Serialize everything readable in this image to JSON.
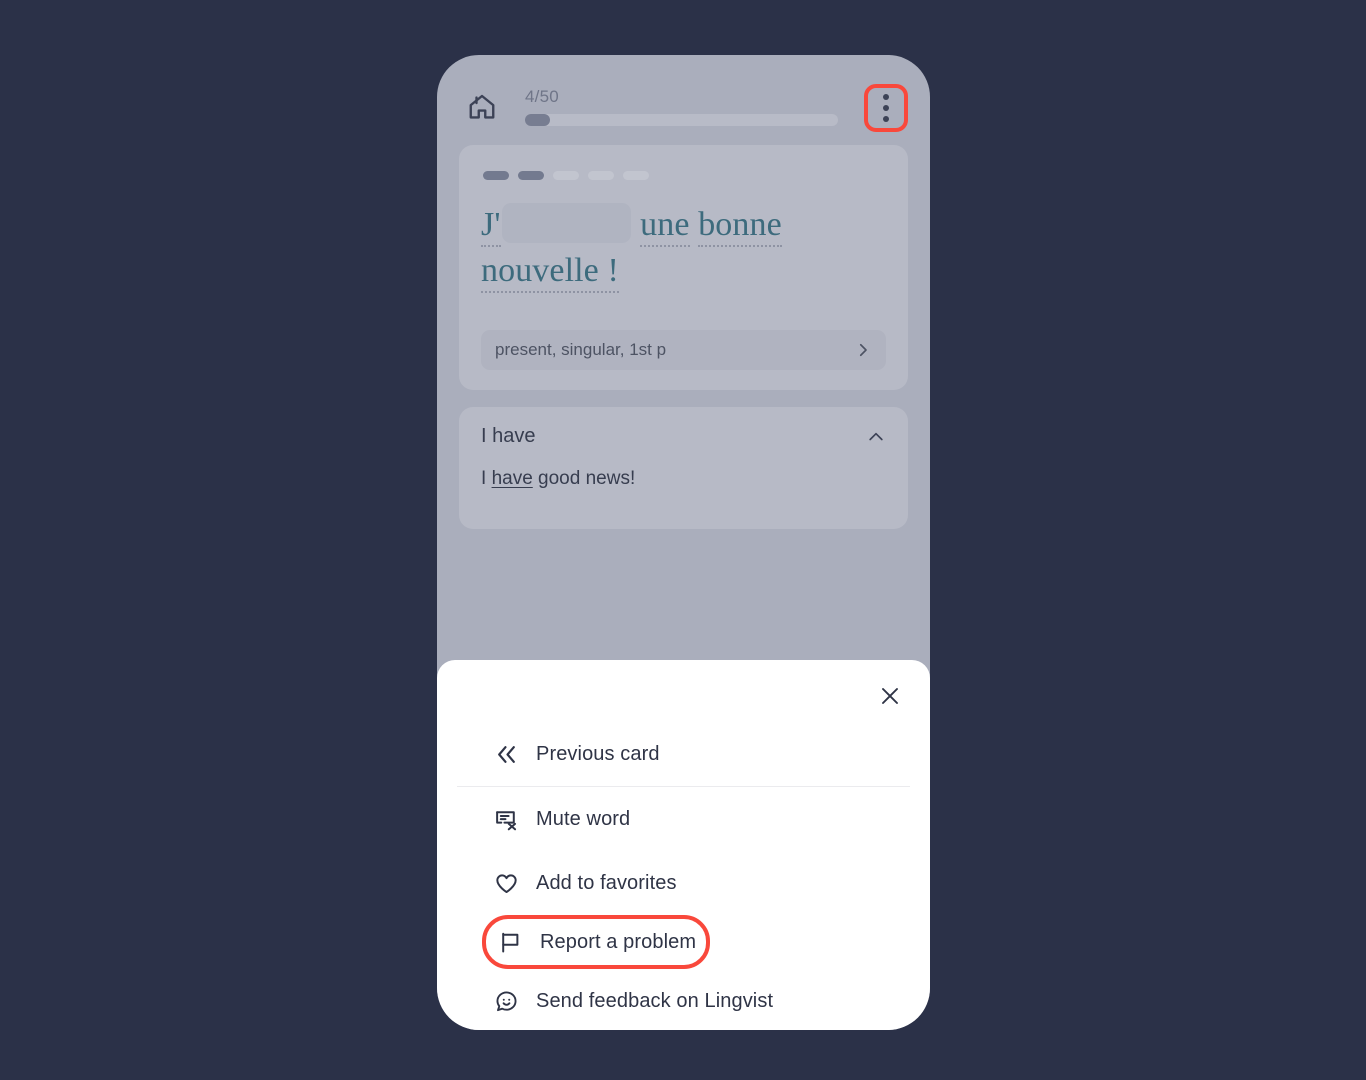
{
  "app": {
    "background_color": "#2b3148",
    "screen_color": "#aaaebc",
    "accent_highlight_color": "#f9483b",
    "sentence_color": "#3d6b7d"
  },
  "header": {
    "home_icon": "home-icon",
    "progress_label": "4/50",
    "progress_current": 4,
    "progress_total": 50,
    "progress_percent": 8,
    "menu_icon": "kebab-menu-icon",
    "menu_highlighted": true
  },
  "question_card": {
    "letter_hints": [
      {
        "filled": true
      },
      {
        "filled": true
      },
      {
        "filled": false
      },
      {
        "filled": false
      },
      {
        "filled": false
      }
    ],
    "sentence_prefix": "J'",
    "blank_placeholder": "",
    "sentence_word_1": "une",
    "sentence_word_2": "bonne",
    "sentence_word_3": "nouvelle !",
    "full_sentence": "J'___ une bonne nouvelle !",
    "grammar_hint": "present, singular, 1st p",
    "grammar_chevron_icon": "chevron-right-icon"
  },
  "answer_card": {
    "title": "I have",
    "collapse_icon": "chevron-up-icon",
    "example_prefix": "I ",
    "example_highlight": "have",
    "example_suffix": " good news!",
    "example_full": "I have good news!"
  },
  "sheet": {
    "close_icon": "close-icon",
    "items": [
      {
        "label": "Previous card",
        "icon": "double-chevron-left-icon",
        "highlighted": false,
        "separator_after": true
      },
      {
        "label": "Mute word",
        "icon": "mute-word-icon",
        "highlighted": false,
        "separator_after": false
      },
      {
        "label": "Add to favorites",
        "icon": "heart-icon",
        "highlighted": false,
        "separator_after": false
      },
      {
        "label": "Report a problem",
        "icon": "flag-icon",
        "highlighted": true,
        "separator_after": false
      },
      {
        "label": "Send feedback on Lingvist",
        "icon": "feedback-smiley-icon",
        "highlighted": false,
        "separator_after": false
      }
    ]
  }
}
